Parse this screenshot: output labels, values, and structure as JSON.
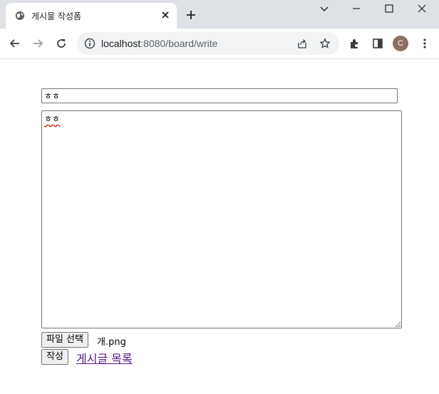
{
  "browser": {
    "tab_title": "게시물 작성폼",
    "url_host": "localhost",
    "url_path": ":8080/board/write",
    "profile_initial": "C"
  },
  "form": {
    "title_value": "ㅎㅎ",
    "content_value": "ㅎㅎ",
    "file_button_label": "파일 선택",
    "file_name": "개.png",
    "submit_label": "작성",
    "list_link_label": "게시글 목록"
  },
  "colors": {
    "tabstrip": "#dee1e6",
    "omnibox": "#f1f3f4",
    "visited_link": "#551a8b",
    "avatar": "#8d6e63"
  }
}
